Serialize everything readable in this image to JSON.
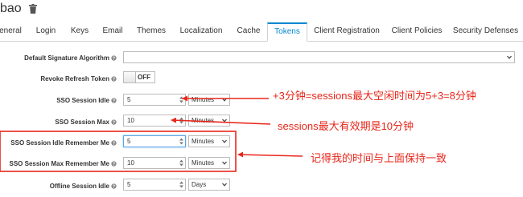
{
  "header": {
    "realm_name": "bao",
    "delete_icon": "trash-icon"
  },
  "tabs": [
    {
      "label": "eneral"
    },
    {
      "label": "Login"
    },
    {
      "label": "Keys"
    },
    {
      "label": "Email"
    },
    {
      "label": "Themes"
    },
    {
      "label": "Localization"
    },
    {
      "label": "Cache"
    },
    {
      "label": "Tokens",
      "active": true
    },
    {
      "label": "Client Registration"
    },
    {
      "label": "Client Policies"
    },
    {
      "label": "Security Defenses"
    }
  ],
  "form": {
    "default_signature_algorithm": {
      "label": "Default Signature Algorithm",
      "value": ""
    },
    "revoke_refresh_token": {
      "label": "Revoke Refresh Token",
      "toggle": "OFF"
    },
    "sso_session_idle": {
      "label": "SSO Session Idle",
      "value": "5",
      "unit": "Minutes"
    },
    "sso_session_max": {
      "label": "SSO Session Max",
      "value": "10",
      "unit": "Minutes"
    },
    "sso_idle_remember_me": {
      "label": "SSO Session Idle Remember Me",
      "value": "5",
      "unit": "Minutes"
    },
    "sso_max_remember_me": {
      "label": "SSO Session Max Remember Me",
      "value": "10",
      "unit": "Minutes"
    },
    "offline_session_idle": {
      "label": "Offline Session Idle",
      "value": "5",
      "unit": "Days"
    }
  },
  "annotations": {
    "note1": "+3分钟=sessions最大空闲时间为5+3=8分钟",
    "note2": "sessions最大有效期是10分钟",
    "note3": "记得我的时间与上面保持一致",
    "color": "#e8261a"
  },
  "colors": {
    "accent": "#0088ce"
  }
}
